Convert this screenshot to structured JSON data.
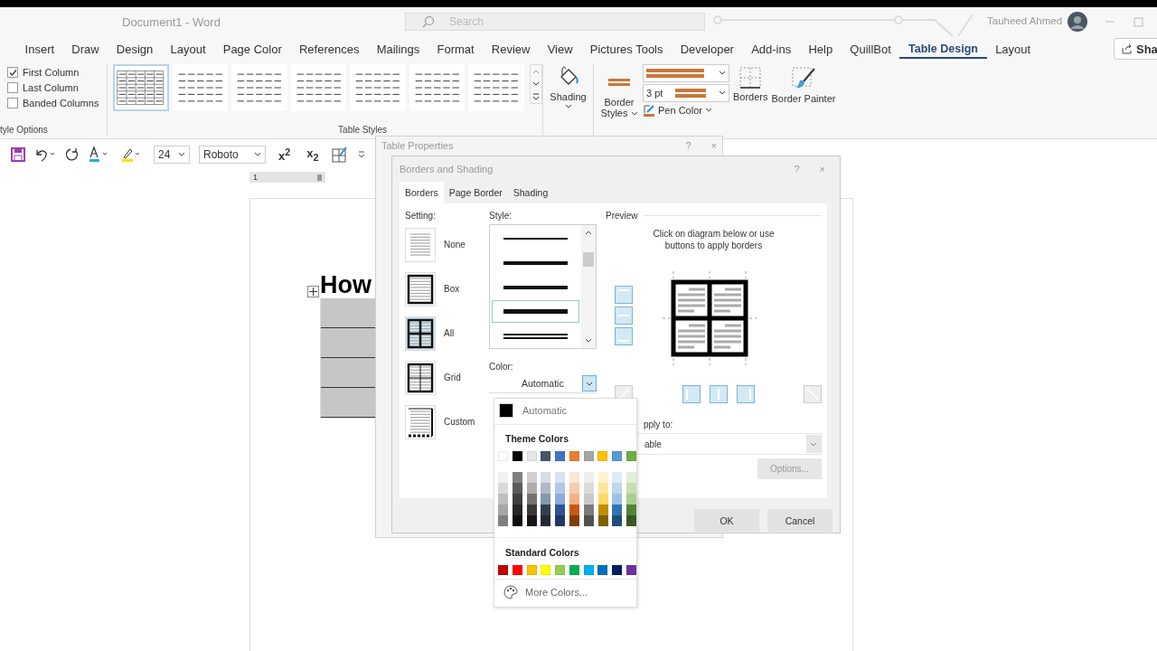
{
  "title_bar": {
    "document_title": "Document1  -  Word",
    "search_placeholder": "Search",
    "user_name": "Tauheed Ahmed"
  },
  "ribbon_tabs": [
    {
      "label": "Insert",
      "selected": false
    },
    {
      "label": "Draw",
      "selected": false
    },
    {
      "label": "Design",
      "selected": false
    },
    {
      "label": "Layout",
      "selected": false
    },
    {
      "label": "Page Color",
      "selected": false
    },
    {
      "label": "References",
      "selected": false
    },
    {
      "label": "Mailings",
      "selected": false
    },
    {
      "label": "Format",
      "selected": false
    },
    {
      "label": "Review",
      "selected": false
    },
    {
      "label": "View",
      "selected": false
    },
    {
      "label": "Pictures Tools",
      "selected": false
    },
    {
      "label": "Developer",
      "selected": false
    },
    {
      "label": "Add-ins",
      "selected": false
    },
    {
      "label": "Help",
      "selected": false
    },
    {
      "label": "QuillBot",
      "selected": false
    },
    {
      "label": "Table Design",
      "selected": true
    },
    {
      "label": "Layout",
      "selected": false
    }
  ],
  "share_button": "Sha",
  "ribbon": {
    "style_options": [
      {
        "label": "First Column",
        "checked": true
      },
      {
        "label": "Last Column",
        "checked": false
      },
      {
        "label": "Banded Columns",
        "checked": false
      }
    ],
    "style_options_group": "tyle Options",
    "table_styles": [
      {
        "selected": true
      },
      {
        "selected": false
      },
      {
        "selected": false
      },
      {
        "selected": false
      },
      {
        "selected": false
      },
      {
        "selected": false
      },
      {
        "selected": false
      }
    ],
    "table_styles_group": "Table Styles",
    "shading_label": "Shading",
    "border_styles_label": "Border Styles",
    "line_weight": "3 pt",
    "pen_color_label": "Pen Color",
    "borders_label": "Borders",
    "border_painter_label": "Border Painter"
  },
  "quick_access": {
    "font_size": "24",
    "font_name": "Roboto",
    "superscript": "x$^{2}$",
    "subscript": "x$_{2}$"
  },
  "ruler": {
    "page_number": "1"
  },
  "document": {
    "heading": "How"
  },
  "table_properties": {
    "title": "Table Properties",
    "help": "?",
    "close": "×"
  },
  "borders_dialog": {
    "title": "Borders and Shading",
    "help": "?",
    "close": "×",
    "tabs": [
      {
        "label": "Borders",
        "selected": true
      },
      {
        "label": "Page Border",
        "selected": false
      },
      {
        "label": "Shading",
        "selected": false
      }
    ],
    "setting_label": "Setting:",
    "settings": [
      {
        "label": "None",
        "kind": "none",
        "selected": false
      },
      {
        "label": "Box",
        "kind": "box",
        "selected": false
      },
      {
        "label": "All",
        "kind": "all",
        "selected": true
      },
      {
        "label": "Grid",
        "kind": "grid",
        "selected": false
      },
      {
        "label": "Custom",
        "kind": "custom",
        "selected": false
      }
    ],
    "style_label": "Style:",
    "styles": [
      {
        "kind": "thin",
        "selected": false
      },
      {
        "kind": "medium",
        "selected": false
      },
      {
        "kind": "medium",
        "selected": false
      },
      {
        "kind": "heavy",
        "selected": true
      },
      {
        "kind": "double",
        "selected": false
      }
    ],
    "color_label": "Color:",
    "color_value": "Automatic",
    "preview_label": "Preview",
    "preview_hint": "Click on diagram below or use buttons to apply borders",
    "side_buttons": [
      {
        "kind": "top",
        "disabled": false
      },
      {
        "kind": "middle",
        "disabled": false
      },
      {
        "kind": "bottom",
        "disabled": false
      }
    ],
    "bottom_buttons": [
      {
        "kind": "diagonal-up",
        "disabled": true
      },
      {
        "kind": "left",
        "disabled": false
      },
      {
        "kind": "center",
        "disabled": false
      },
      {
        "kind": "right",
        "disabled": false
      },
      {
        "kind": "diagonal-down",
        "disabled": true
      }
    ],
    "apply_to_label": "pply to:",
    "apply_to_value": "able",
    "options_button": {
      "label": "Options...",
      "disabled": true
    },
    "buttons": [
      "OK",
      "Cancel"
    ]
  },
  "color_menu": {
    "automatic": {
      "label": "Automatic",
      "color": "#000000"
    },
    "theme_title": "Theme Colors",
    "theme_colors": [
      {
        "color": "#ffffff",
        "shades": [
          {
            "color": "#f2f2f2"
          },
          {
            "color": "#d9d9d9"
          },
          {
            "color": "#bfbfbf"
          },
          {
            "color": "#a6a6a6"
          },
          {
            "color": "#808080"
          }
        ]
      },
      {
        "color": "#000000",
        "shades": [
          {
            "color": "#808080"
          },
          {
            "color": "#595959"
          },
          {
            "color": "#404040"
          },
          {
            "color": "#262626"
          },
          {
            "color": "#0d0d0d"
          }
        ]
      },
      {
        "color": "#e7e6e6",
        "shades": [
          {
            "color": "#d0cece"
          },
          {
            "color": "#aeabab"
          },
          {
            "color": "#757171"
          },
          {
            "color": "#3b3838"
          },
          {
            "color": "#161616"
          }
        ]
      },
      {
        "color": "#44546a",
        "shades": [
          {
            "color": "#d6dce4"
          },
          {
            "color": "#adb9ca"
          },
          {
            "color": "#8496b0"
          },
          {
            "color": "#333f4f"
          },
          {
            "color": "#222a35"
          }
        ]
      },
      {
        "color": "#4472c4",
        "shades": [
          {
            "color": "#d9e2f3"
          },
          {
            "color": "#b4c6e7"
          },
          {
            "color": "#8eaadb"
          },
          {
            "color": "#2f5496"
          },
          {
            "color": "#1f3864"
          }
        ]
      },
      {
        "color": "#ed7d31",
        "shades": [
          {
            "color": "#fbe5d5"
          },
          {
            "color": "#f7cbac"
          },
          {
            "color": "#f4b083"
          },
          {
            "color": "#c55a11"
          },
          {
            "color": "#833c0b"
          }
        ]
      },
      {
        "color": "#a5a5a5",
        "shades": [
          {
            "color": "#ededed"
          },
          {
            "color": "#dbdbdb"
          },
          {
            "color": "#c9c9c9"
          },
          {
            "color": "#7b7b7b"
          },
          {
            "color": "#525252"
          }
        ]
      },
      {
        "color": "#ffc000",
        "shades": [
          {
            "color": "#fff2cc"
          },
          {
            "color": "#ffe599"
          },
          {
            "color": "#ffd966"
          },
          {
            "color": "#bf8f00"
          },
          {
            "color": "#7f6000"
          }
        ]
      },
      {
        "color": "#5b9bd5",
        "shades": [
          {
            "color": "#deebf6"
          },
          {
            "color": "#bdd7ee"
          },
          {
            "color": "#9cc3e5"
          },
          {
            "color": "#2e75b5"
          },
          {
            "color": "#1e4e79"
          }
        ]
      },
      {
        "color": "#70ad47",
        "shades": [
          {
            "color": "#e2efd9"
          },
          {
            "color": "#c5e0b3"
          },
          {
            "color": "#a8d08d"
          },
          {
            "color": "#538135"
          },
          {
            "color": "#375623"
          }
        ]
      }
    ],
    "standard_title": "Standard Colors",
    "standard_colors": [
      {
        "color": "#c00000"
      },
      {
        "color": "#ff0000"
      },
      {
        "color": "#ffc000"
      },
      {
        "color": "#ffff00"
      },
      {
        "color": "#92d050"
      },
      {
        "color": "#00b050"
      },
      {
        "color": "#00b0f0"
      },
      {
        "color": "#0070c0"
      },
      {
        "color": "#002060"
      },
      {
        "color": "#7030a0"
      }
    ],
    "more_colors": "More Colors..."
  }
}
